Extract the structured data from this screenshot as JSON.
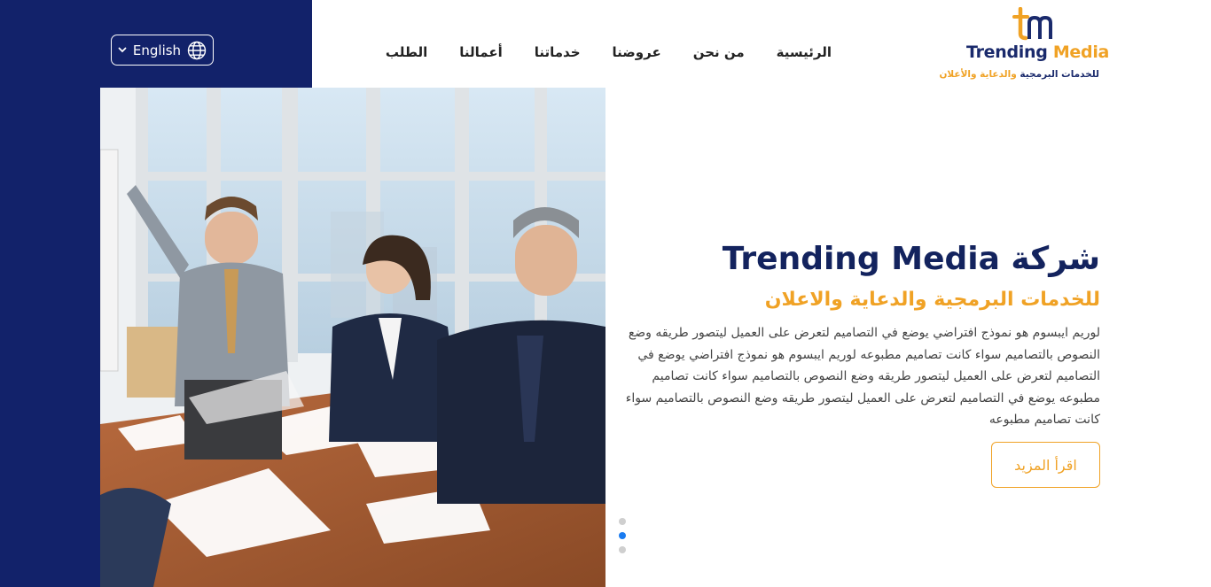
{
  "header": {
    "language_label": "English",
    "nav": [
      {
        "label": "الرئيسية"
      },
      {
        "label": "من نحن"
      },
      {
        "label": "عروضنا"
      },
      {
        "label": "خدماتنا"
      },
      {
        "label": "أعمالنا"
      },
      {
        "label": "الطلب"
      }
    ],
    "logo": {
      "word1": "Trending",
      "word2": "Media",
      "sub1": "للخدمات البرمجية",
      "sub2": "والدعاية والأعلان"
    }
  },
  "hero": {
    "title": "شركة Trending Media",
    "subtitle": "للخدمات البرمجية والدعاية والاعلان",
    "text": "لوريم ايبسوم هو نموذج افتراضي يوضع في التصاميم لتعرض على العميل ليتصور طريقه وضع النصوص بالتصاميم سواء كانت تصاميم مطبوعه لوريم ايبسوم هو نموذج افتراضي يوضع في التصاميم لتعرض على العميل ليتصور طريقه وضع النصوص بالتصاميم سواء كانت تصاميم مطبوعه يوضع في التصاميم لتعرض على العميل ليتصور طريقه وضع النصوص بالتصاميم سواء كانت تصاميم مطبوعه",
    "button_label": "اقرأ المزيد"
  },
  "slider": {
    "count": 3,
    "active_index": 1
  },
  "colors": {
    "navy": "#12226a",
    "accent": "#f0a225",
    "title": "#13235e",
    "dot_active": "#1a7bf0"
  },
  "icons": {
    "language": "globe-icon",
    "dropdown": "chevron-down-icon"
  }
}
